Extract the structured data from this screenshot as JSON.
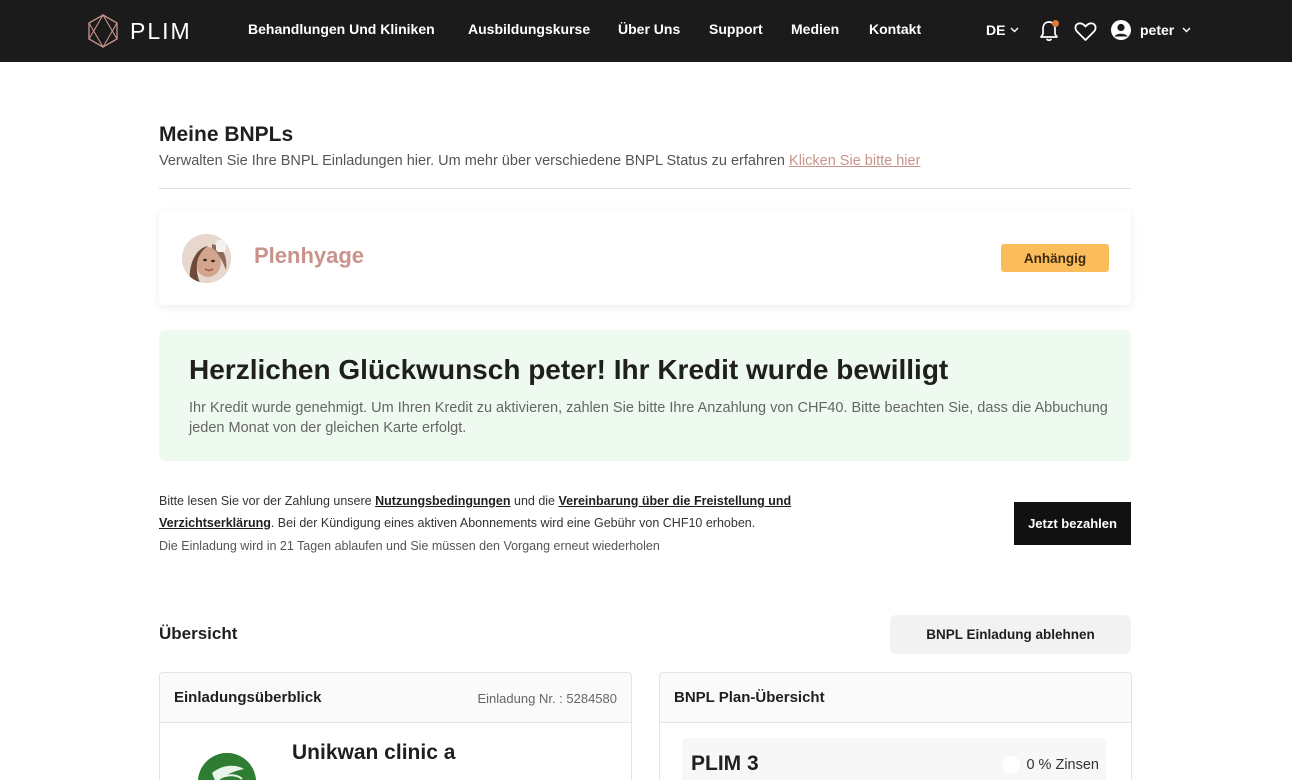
{
  "nav": {
    "logo": "PLIM",
    "items": [
      "Behandlungen Und Kliniken",
      "Ausbildungskurse",
      "Über Uns",
      "Support",
      "Medien",
      "Kontakt"
    ],
    "language": "DE",
    "user": "peter"
  },
  "header": {
    "title": "Meine BNPLs",
    "subtitle": "Verwalten Sie Ihre BNPL Einladungen hier. Um mehr über verschiedene BNPL Status zu erfahren",
    "link": "Klicken Sie bitte hier"
  },
  "clinic_card": {
    "name": "Plenhyage",
    "status": "Anhängig",
    "status_color": "#fbbd5b"
  },
  "congrats": {
    "title": "Herzlichen Glückwunsch peter! Ihr Kredit wurde bewilligt",
    "text": "Ihr Kredit wurde genehmigt. Um Ihren Kredit zu aktivieren, zahlen Sie bitte Ihre Anzahlung von CHF40. Bitte beachten Sie, dass die Abbuchung jeden Monat von der gleichen Karte erfolgt."
  },
  "terms": {
    "pre": "Bitte lesen Sie vor der Zahlung unsere",
    "link1": "Nutzungsbedingungen",
    "mid": "und die",
    "link2": "Vereinbarung über die Freistellung und Verzichtserklärung",
    "post": ". Bei der Kündigung eines aktiven Abonnements wird eine Gebühr von CHF10 erhoben.",
    "expire": "Die Einladung wird in 21 Tagen ablaufen und Sie müssen den Vorgang erneut wiederholen",
    "pay_button": "Jetzt bezahlen"
  },
  "overview": {
    "title": "Übersicht",
    "decline_button": "BNPL Einladung ablehnen",
    "invite_panel": {
      "title": "Einladungsüberblick",
      "invite_no": "Einladung Nr. : 5284580",
      "clinic_name": "Unikwan clinic a"
    },
    "plan_panel": {
      "title": "BNPL Plan-Übersicht",
      "plan_name": "PLIM 3",
      "interest": "0 % Zinsen"
    }
  },
  "colors": {
    "accent": "#c9938a",
    "topbar": "#1b1b1b",
    "success_bg": "#eef9f0",
    "notification": "#e07a3c"
  }
}
